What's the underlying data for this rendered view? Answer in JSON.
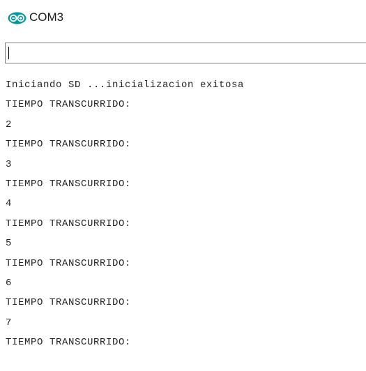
{
  "window": {
    "title": "COM3",
    "icon": "arduino-infinity-icon",
    "accent": "#00979c"
  },
  "input": {
    "value": "",
    "placeholder": ""
  },
  "serial_output": [
    "Iniciando SD ...inicializacion exitosa",
    "TIEMPO TRANSCURRIDO:",
    "2",
    "TIEMPO TRANSCURRIDO:",
    "3",
    "TIEMPO TRANSCURRIDO:",
    "4",
    "TIEMPO TRANSCURRIDO:",
    "5",
    "TIEMPO TRANSCURRIDO:",
    "6",
    "TIEMPO TRANSCURRIDO:",
    "7",
    "TIEMPO TRANSCURRIDO:"
  ]
}
